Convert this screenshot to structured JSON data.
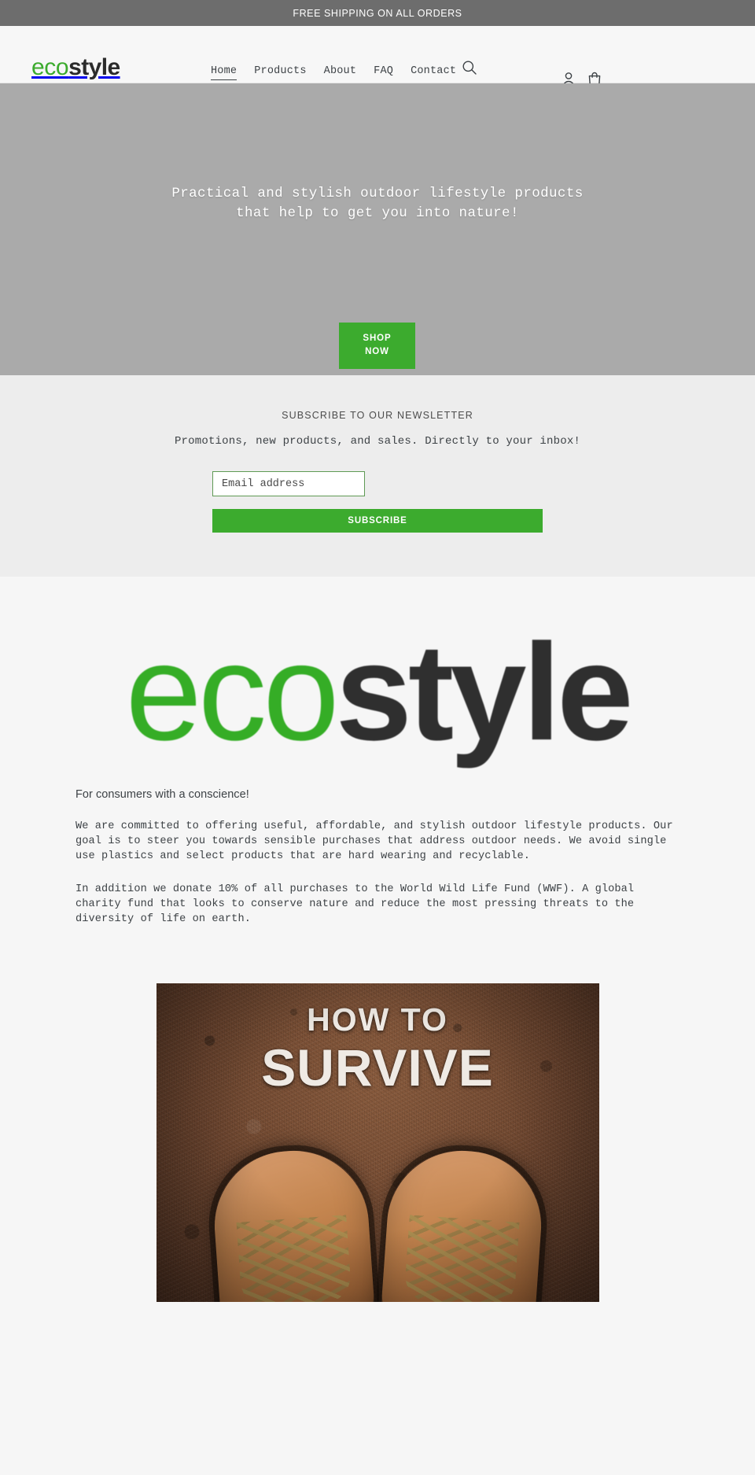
{
  "announcement": {
    "text": "FREE SHIPPING ON ALL ORDERS"
  },
  "header": {
    "logo": {
      "part1": "eco",
      "part2": "style"
    },
    "nav": [
      {
        "label": "Home",
        "active": true
      },
      {
        "label": "Products",
        "active": false
      },
      {
        "label": "About",
        "active": false
      },
      {
        "label": "FAQ",
        "active": false
      },
      {
        "label": "Contact",
        "active": false
      }
    ],
    "icons": {
      "search": "search-icon",
      "account": "account-icon",
      "cart": "cart-icon"
    }
  },
  "hero": {
    "line1": "Practical and stylish outdoor lifestyle products",
    "line2": "that help to get you into nature!",
    "cta_line1": "SHOP",
    "cta_line2": "NOW",
    "background_color": "#aaaaaa",
    "accent_color": "#3cab2e"
  },
  "newsletter": {
    "title": "SUBSCRIBE TO OUR NEWSLETTER",
    "subtitle": "Promotions, new products, and sales. Directly to your inbox!",
    "email_placeholder": "Email address",
    "email_value": "",
    "submit_label": "SUBSCRIBE",
    "background_color": "#ededed"
  },
  "main": {
    "brand_logo": {
      "part1": "eco",
      "part2": "style"
    },
    "lead": "For consumers with a conscience!",
    "paragraph1": "We are committed to offering useful, affordable, and stylish outdoor lifestyle products.  Our goal is to steer you towards sensible purchases that address outdoor needs. We avoid single use plastics and select products that are hard wearing and recyclable.",
    "paragraph2": "In addition we donate 10% of all purchases to the World Wild Life Fund (WWF). A global charity fund that looks to conserve nature and reduce the most pressing threats to the diversity of life on earth.",
    "photo": {
      "caption_line1": "HOW TO",
      "caption_line2": "SURVIVE"
    }
  }
}
